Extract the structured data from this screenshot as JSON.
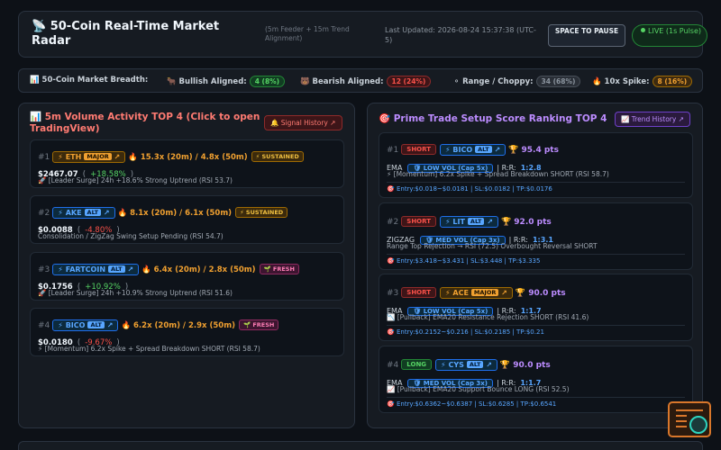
{
  "header": {
    "icon": "satellite-icon",
    "title": "50-Coin Real-Time Market Radar",
    "subtitle": "(5m Feeder + 15m Trend Alignment)",
    "last_updated": "Last Updated: 2026-08-24 15:37:38 (UTC-5)",
    "space_button": "SPACE TO PAUSE",
    "live_button": "LIVE (1s Pulse)"
  },
  "breadth": {
    "label": "50-Coin Market Breadth:",
    "bullish_label": "Bullish Aligned:",
    "bullish_value": "4 (8%)",
    "bearish_label": "Bearish Aligned:",
    "bearish_value": "12 (24%)",
    "range_label": "Range / Choppy:",
    "range_value": "34 (68%)",
    "spike_label": "10x Spike:",
    "spike_value": "8 (16%)"
  },
  "left_panel": {
    "title": "5m Volume Activity TOP 4 (Click to open TradingView)",
    "button": "Signal History ↗",
    "items": [
      {
        "rank": "#1",
        "coin": "ETH",
        "type": "MAJOR",
        "volume": "15.3x (20m) / 4.8x (50m)",
        "badge": "SUSTAINED",
        "price": "$2467.07",
        "open": "(",
        "change": "+18.58%",
        "close": ")",
        "desc": "[Leader Surge] 24h +18.6% Strong Uptrend (RSI 53.7)"
      },
      {
        "rank": "#2",
        "coin": "AKE",
        "type": "ALT",
        "volume": "8.1x (20m) / 6.1x (50m)",
        "badge": "SUSTAINED",
        "price": "$0.0088",
        "open": "(",
        "change": "-4.80%",
        "close": ")",
        "desc": "Consolidation / ZigZag Swing Setup Pending (RSI 54.7)"
      },
      {
        "rank": "#3",
        "coin": "FARTCOIN",
        "type": "ALT",
        "volume": "6.4x (20m) / 2.8x (50m)",
        "badge": "FRESH",
        "price": "$0.1756",
        "open": "(",
        "change": "+10.92%",
        "close": ")",
        "desc": "[Leader Surge] 24h +10.9% Strong Uptrend (RSI 51.6)"
      },
      {
        "rank": "#4",
        "coin": "BICO",
        "type": "ALT",
        "volume": "6.2x (20m) / 2.9x (50m)",
        "badge": "FRESH",
        "price": "$0.0180",
        "open": "(",
        "change": "-9.67%",
        "close": ")",
        "desc": "⚡ [Momentum] 6.2x Spike + Spread Breakdown SHORT (RSI 58.7)"
      }
    ]
  },
  "right_panel": {
    "title": "Prime Trade Setup Score Ranking TOP 4",
    "button": "Trend History ↗",
    "rr_label": "R:R:",
    "items": [
      {
        "rank": "#1",
        "side": "SHORT",
        "coin": "BICO",
        "type": "ALT",
        "score": "95.4 pts",
        "strategy": "EMA",
        "vol": "LOW VOL (Cap 5x)",
        "rr": "1:2.8",
        "desc": "⚡ [Momentum] 6.2x Spike + Spread Breakdown SHORT (RSI 58.7)",
        "entry": "Entry:$0.018~$0.0181 | SL:$0.0182 | TP:$0.0176"
      },
      {
        "rank": "#2",
        "side": "SHORT",
        "coin": "LIT",
        "type": "ALT",
        "score": "92.0 pts",
        "strategy": "ZIGZAG",
        "vol": "MED VOL (Cap 3x)",
        "rr": "1:3.1",
        "desc": "Range Top Rejection → RSI (72.5) Overbought Reversal SHORT",
        "entry": "Entry:$3.418~$3.431 | SL:$3.448 | TP:$3.335"
      },
      {
        "rank": "#3",
        "side": "SHORT",
        "coin": "ACE",
        "type": "MAJOR",
        "score": "90.0 pts",
        "strategy": "EMA",
        "vol": "LOW VOL (Cap 5x)",
        "rr": "1:1.7",
        "desc": "[Pullback] EMA20 Resistance Rejection SHORT (RSI 41.6)",
        "entry": "Entry:$0.2152~$0.216 | SL:$0.2185 | TP:$0.21"
      },
      {
        "rank": "#4",
        "side": "LONG",
        "coin": "CYS",
        "type": "ALT",
        "score": "90.0 pts",
        "strategy": "EMA",
        "vol": "MED VOL (Cap 3x)",
        "rr": "1:1.7",
        "desc": "[Pullback] EMA20 Support Bounce LONG (RSI 52.5)",
        "entry": "Entry:$0.6362~$0.6387 | SL:$0.6285 | TP:$0.6541"
      }
    ]
  }
}
